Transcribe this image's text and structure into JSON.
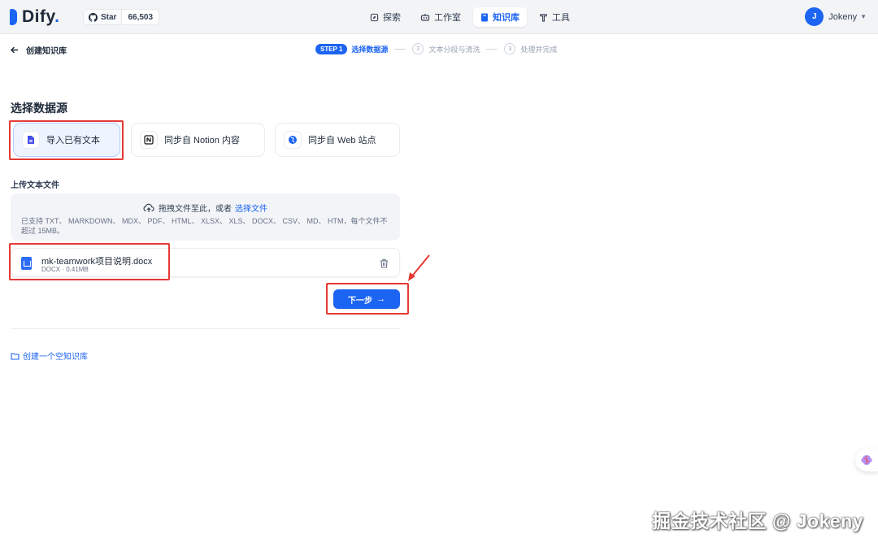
{
  "app": {
    "name": "Dify",
    "name_suffix": "."
  },
  "github": {
    "star_label": "Star",
    "star_count": "66,503"
  },
  "nav": {
    "items": [
      {
        "label": "探索",
        "icon": "compass-icon",
        "active": false
      },
      {
        "label": "工作室",
        "icon": "robot-icon",
        "active": false
      },
      {
        "label": "知识库",
        "icon": "book-icon",
        "active": true
      },
      {
        "label": "工具",
        "icon": "hammer-icon",
        "active": false
      }
    ]
  },
  "user": {
    "initial": "J",
    "name": "Jokeny"
  },
  "header": {
    "back_label": "创建知识库",
    "steps": [
      {
        "badge": "STEP 1",
        "label": "选择数据源",
        "active": true
      },
      {
        "num": "2",
        "label": "文本分段与清洗",
        "active": false
      },
      {
        "num": "3",
        "label": "处理并完成",
        "active": false
      }
    ]
  },
  "main": {
    "section_title": "选择数据源",
    "datasources": [
      {
        "label": "导入已有文本",
        "icon": "file-text-icon",
        "selected": true
      },
      {
        "label": "同步自 Notion 内容",
        "icon": "notion-icon",
        "selected": false
      },
      {
        "label": "同步自 Web 站点",
        "icon": "globe-icon",
        "selected": false
      }
    ],
    "upload_label": "上传文本文件",
    "dropzone": {
      "text": "拖拽文件至此，或者",
      "link": "选择文件",
      "hint": "已支持 TXT、 MARKDOWN、 MDX、 PDF、 HTML、 XLSX、 XLS、 DOCX、 CSV、 MD、 HTM，每个文件不超过 15MB。"
    },
    "file": {
      "name": "mk-teamwork项目说明.docx",
      "meta": "DOCX · 0.41MB"
    },
    "next_label": "下一步",
    "next_arrow": "→",
    "empty_link": "创建一个空知识库"
  },
  "watermark": "掘金技术社区 @ Jokeny",
  "colors": {
    "accent": "#1c64f2",
    "annotation": "#e53935"
  }
}
